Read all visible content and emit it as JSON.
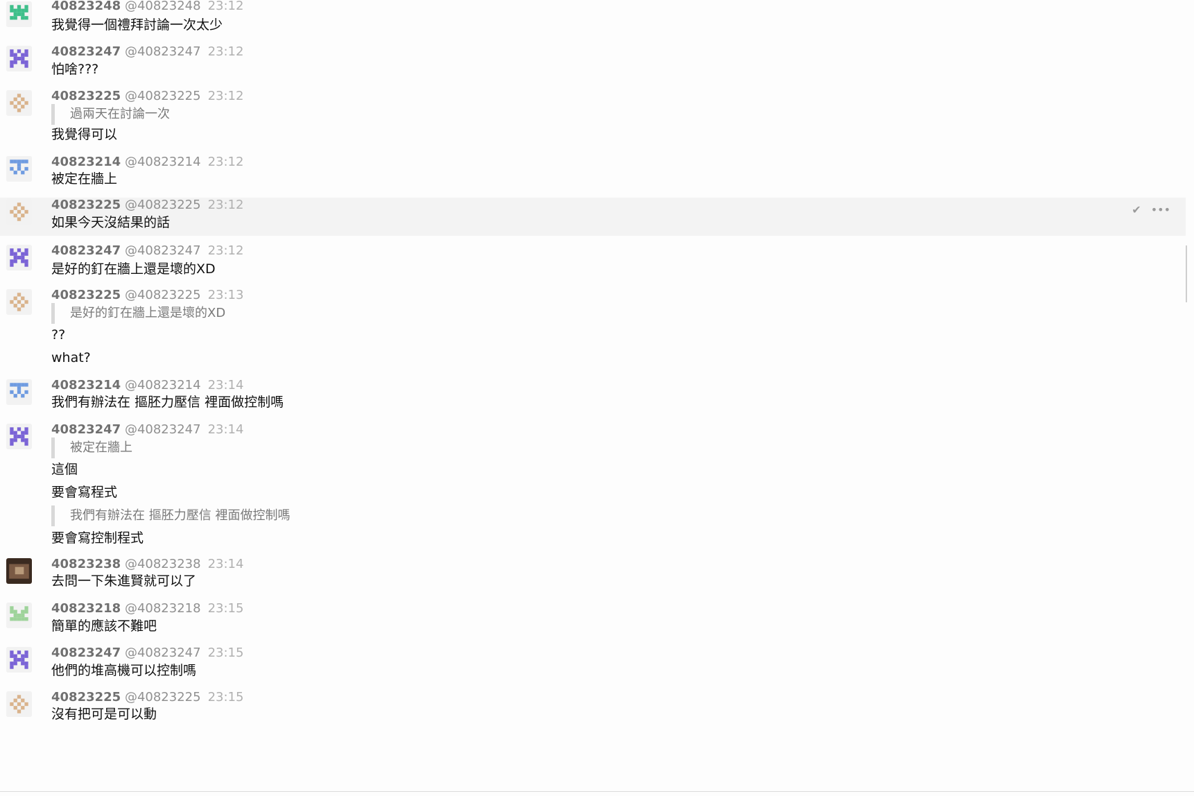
{
  "messages": [
    {
      "user": "40823248",
      "handle": "@40823248",
      "time": "23:12",
      "avatar": "avatar-40823248",
      "blocks": [
        {
          "type": "text",
          "text": "我覺得一個禮拜討論一次太少"
        }
      ]
    },
    {
      "user": "40823247",
      "handle": "@40823247",
      "time": "23:12",
      "avatar": "avatar-40823247",
      "blocks": [
        {
          "type": "text",
          "text": "怕啥???"
        }
      ]
    },
    {
      "user": "40823225",
      "handle": "@40823225",
      "time": "23:12",
      "avatar": "avatar-40823225",
      "blocks": [
        {
          "type": "quote",
          "text": "過兩天在討論一次"
        },
        {
          "type": "text",
          "text": "我覺得可以"
        }
      ]
    },
    {
      "user": "40823214",
      "handle": "@40823214",
      "time": "23:12",
      "avatar": "avatar-40823214",
      "blocks": [
        {
          "type": "text",
          "text": "被定在牆上"
        }
      ]
    },
    {
      "user": "40823225",
      "handle": "@40823225",
      "time": "23:12",
      "avatar": "avatar-40823225",
      "hovered": true,
      "blocks": [
        {
          "type": "text",
          "text": "如果今天沒結果的話"
        }
      ]
    },
    {
      "user": "40823247",
      "handle": "@40823247",
      "time": "23:12",
      "avatar": "avatar-40823247",
      "blocks": [
        {
          "type": "text",
          "text": "是好的釘在牆上還是壞的XD"
        }
      ]
    },
    {
      "user": "40823225",
      "handle": "@40823225",
      "time": "23:13",
      "avatar": "avatar-40823225",
      "blocks": [
        {
          "type": "quote",
          "text": "是好的釘在牆上還是壞的XD"
        },
        {
          "type": "text",
          "text": "??"
        },
        {
          "type": "text",
          "text": "what?"
        }
      ]
    },
    {
      "user": "40823214",
      "handle": "@40823214",
      "time": "23:14",
      "avatar": "avatar-40823214",
      "blocks": [
        {
          "type": "text",
          "text": "我們有辦法在 摳胚力壓信 裡面做控制嗎"
        }
      ]
    },
    {
      "user": "40823247",
      "handle": "@40823247",
      "time": "23:14",
      "avatar": "avatar-40823247",
      "blocks": [
        {
          "type": "quote",
          "text": "被定在牆上"
        },
        {
          "type": "text",
          "text": "這個"
        },
        {
          "type": "text",
          "text": "要會寫程式"
        },
        {
          "type": "quote",
          "text": "我們有辦法在 摳胚力壓信 裡面做控制嗎"
        },
        {
          "type": "text",
          "text": "要會寫控制程式"
        }
      ]
    },
    {
      "user": "40823238",
      "handle": "@40823238",
      "time": "23:14",
      "avatar": "avatar-40823238",
      "blocks": [
        {
          "type": "text",
          "text": "去問一下朱進賢就可以了"
        }
      ]
    },
    {
      "user": "40823218",
      "handle": "@40823218",
      "time": "23:15",
      "avatar": "avatar-40823218",
      "blocks": [
        {
          "type": "text",
          "text": "簡單的應該不難吧"
        }
      ]
    },
    {
      "user": "40823247",
      "handle": "@40823247",
      "time": "23:15",
      "avatar": "avatar-40823247",
      "blocks": [
        {
          "type": "text",
          "text": "他們的堆高機可以控制嗎"
        }
      ]
    },
    {
      "user": "40823225",
      "handle": "@40823225",
      "time": "23:15",
      "avatar": "avatar-40823225",
      "blocks": [
        {
          "type": "text",
          "text": "沒有把可是可以動"
        }
      ]
    }
  ],
  "actions": {
    "check_icon": "✔",
    "more_icon": "•••"
  },
  "colors": {
    "avatar-40823248": "#3ebf8a",
    "avatar-40823247": "#7a63d6",
    "avatar-40823225": "#d9b38c",
    "avatar-40823214": "#6f9be0",
    "avatar-40823218": "#9ed39a",
    "avatar-40823238": "#7a5a44"
  }
}
